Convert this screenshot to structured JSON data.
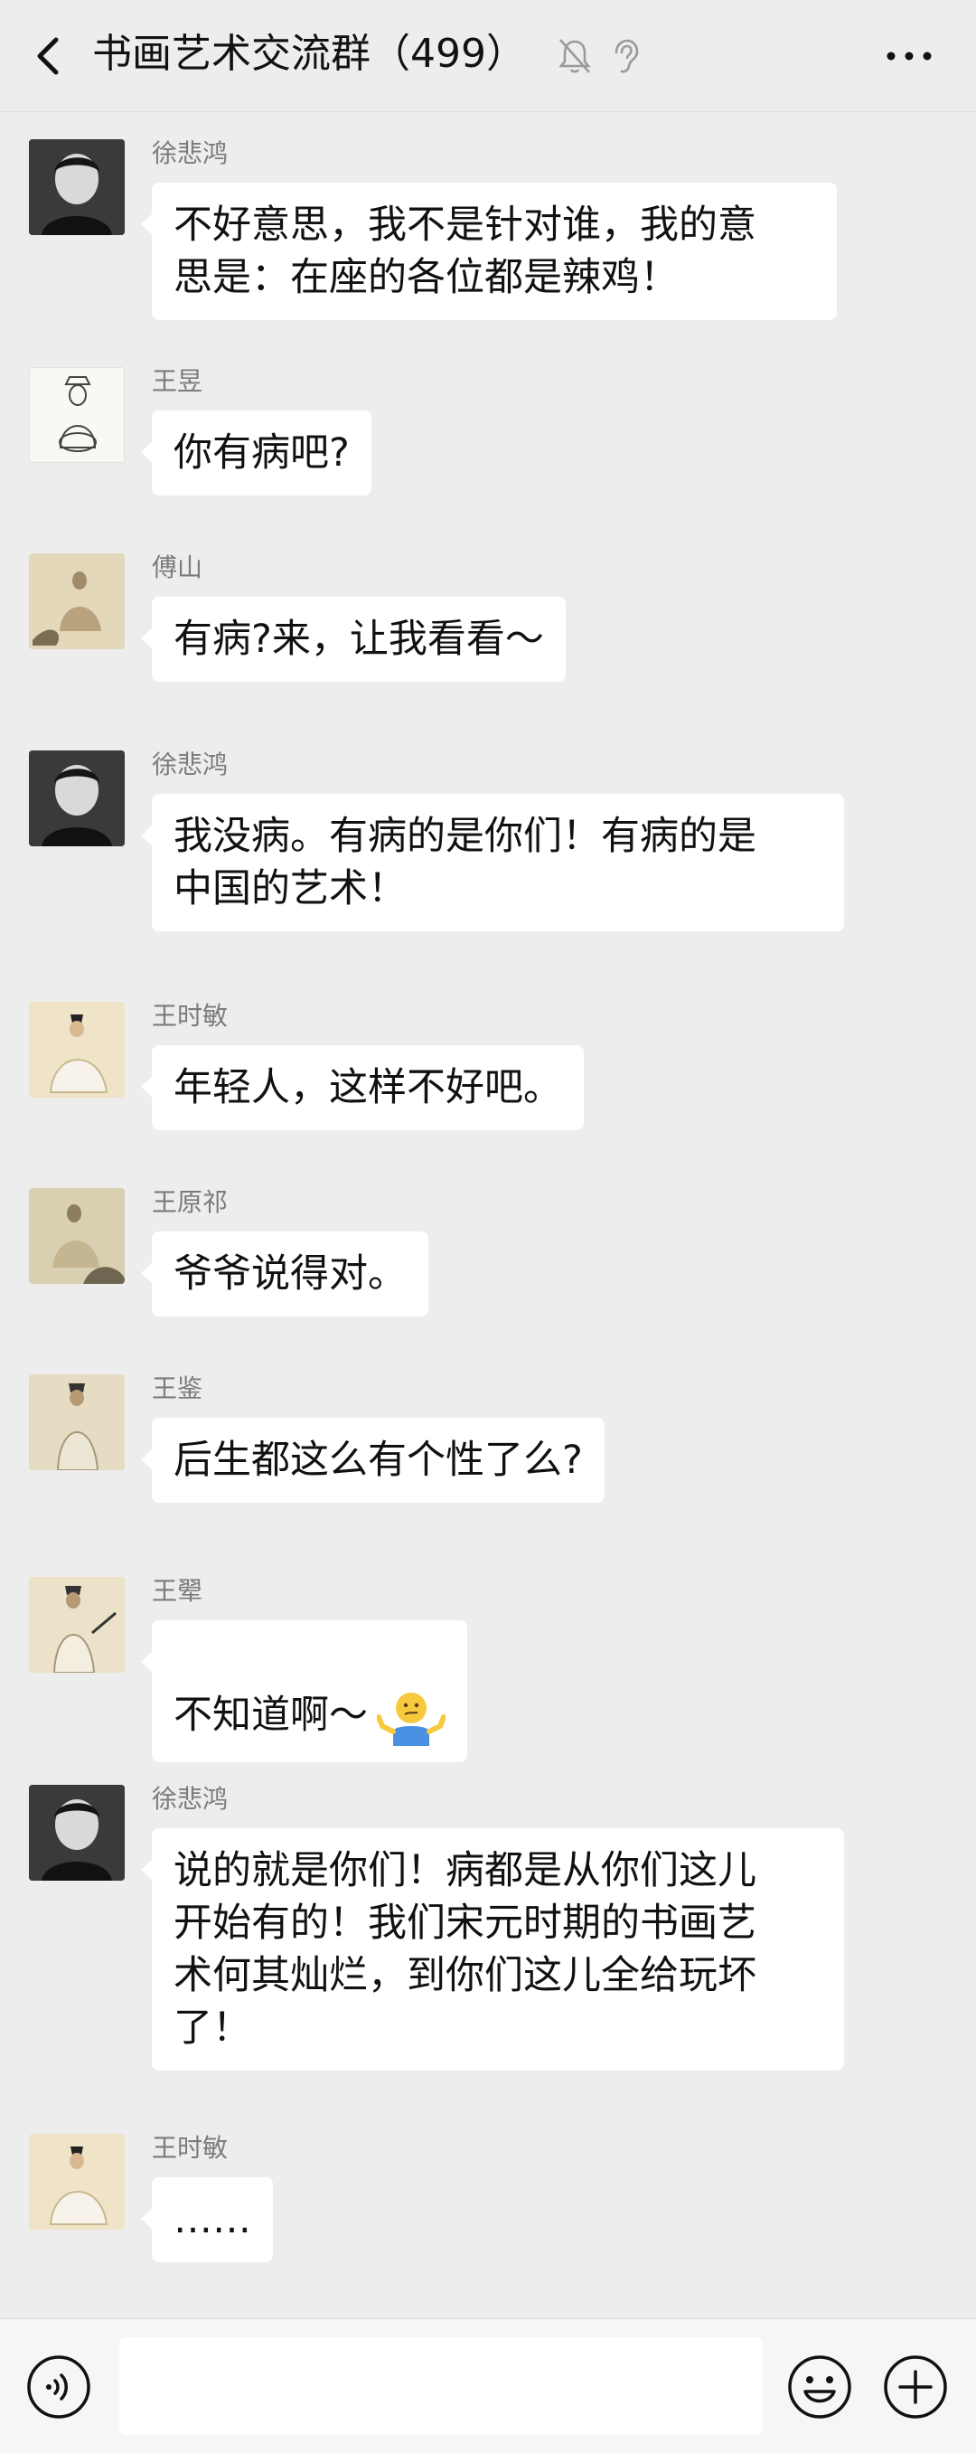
{
  "header": {
    "title": "书画艺术交流群（499）",
    "icons": [
      "back-icon",
      "mute-bell-icon",
      "ear-icon",
      "more-icon"
    ]
  },
  "messages": [
    {
      "sender": "徐悲鸿",
      "text": "不好意思，我不是针对谁，我的意\n思是：在座的各位都是辣鸡！",
      "avatar": "ink-portrait-avatar"
    },
    {
      "sender": "王昱",
      "text": "你有病吧?",
      "avatar": "sketch-figure-avatar"
    },
    {
      "sender": "傅山",
      "text": "有病?来，让我看看～",
      "avatar": "seated-scholar-avatar"
    },
    {
      "sender": "徐悲鸿",
      "text": "我没病。有病的是你们！有病的是\n中国的艺术！",
      "avatar": "ink-portrait-avatar"
    },
    {
      "sender": "王时敏",
      "text": "年轻人，这样不好吧。",
      "avatar": "court-official-avatar"
    },
    {
      "sender": "王原祁",
      "text": "爷爷说得对。",
      "avatar": "seated-scholar-avatar"
    },
    {
      "sender": "王鉴",
      "text": "后生都这么有个性了么?",
      "avatar": "standing-scholar-avatar"
    },
    {
      "sender": "王翚",
      "text": "不知道啊～",
      "emoji": "shrug-emoji",
      "avatar": "standing-scholar-avatar"
    },
    {
      "sender": "徐悲鸿",
      "text": "说的就是你们！病都是从你们这儿\n开始有的！我们宋元时期的书画艺\n术何其灿烂，到你们这儿全给玩坏\n了！",
      "avatar": "ink-portrait-avatar"
    },
    {
      "sender": "王时敏",
      "text": "……",
      "avatar": "court-official-avatar"
    }
  ],
  "input_bar": {
    "placeholder": "",
    "icons": [
      "voice-icon",
      "emoji-icon",
      "plus-icon"
    ]
  },
  "colors": {
    "background": "#ededed",
    "bubble": "#ffffff",
    "sender_name": "#7b7b7b"
  }
}
